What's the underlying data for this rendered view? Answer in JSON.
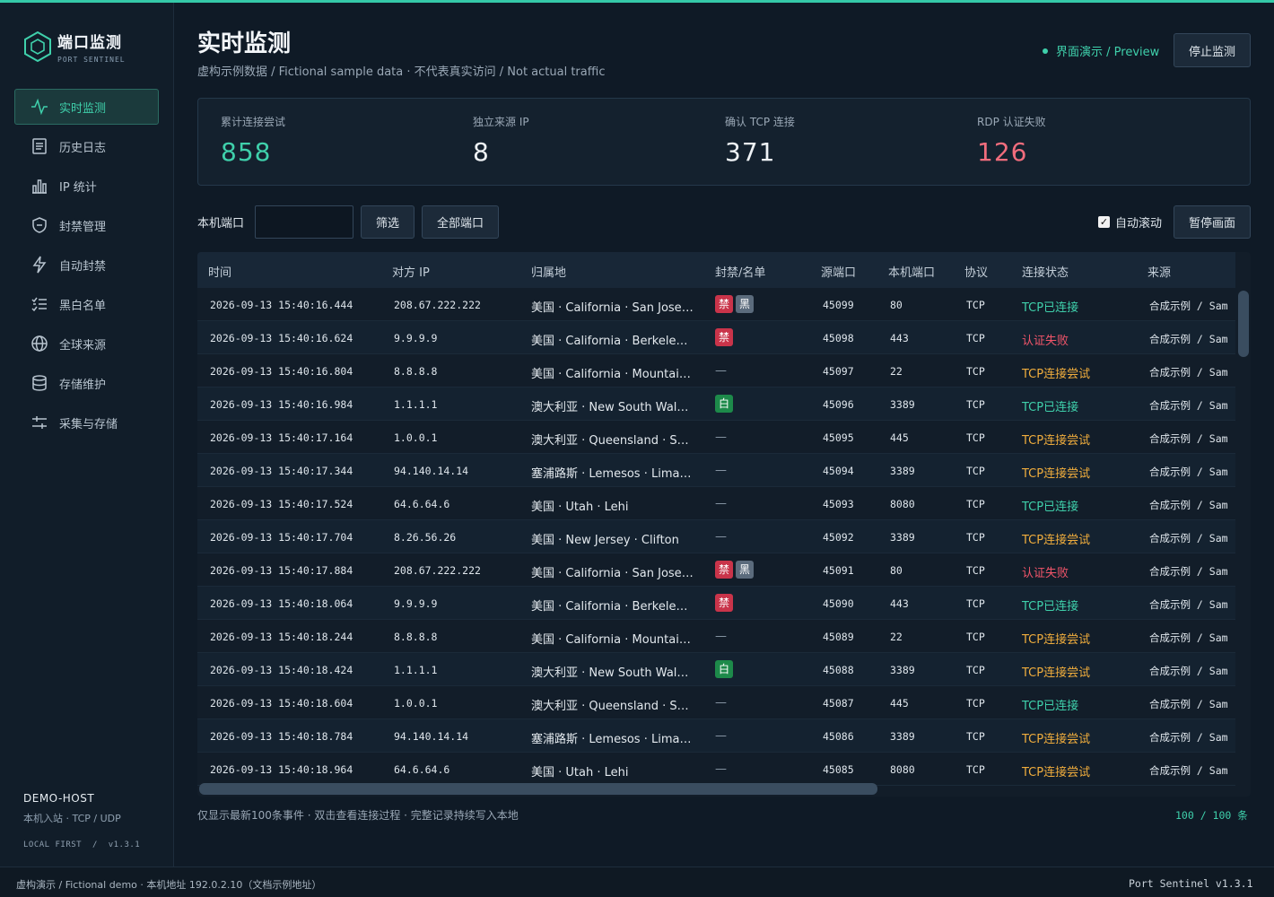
{
  "app": {
    "name": "端口监测",
    "subtitle": "PORT SENTINEL",
    "accent": "#3fd0ab"
  },
  "nav": [
    {
      "label": "实时监测",
      "icon": "pulse-icon",
      "active": true
    },
    {
      "label": "历史日志",
      "icon": "document-icon"
    },
    {
      "label": "IP 统计",
      "icon": "bar-chart-icon"
    },
    {
      "label": "封禁管理",
      "icon": "shield-icon"
    },
    {
      "label": "自动封禁",
      "icon": "lightning-icon"
    },
    {
      "label": "黑白名单",
      "icon": "checklist-icon"
    },
    {
      "label": "全球来源",
      "icon": "globe-icon"
    },
    {
      "label": "存储维护",
      "icon": "database-icon"
    },
    {
      "label": "采集与存储",
      "icon": "sliders-icon"
    }
  ],
  "host": {
    "name": "DEMO-HOST",
    "desc": "本机入站 · TCP / UDP",
    "version": "LOCAL FIRST  /  v1.3.1"
  },
  "header": {
    "title": "实时监测",
    "subtitle": "虚构示例数据 / Fictional sample data · 不代表真实访问 / Not actual traffic",
    "preview": "界面演示 / Preview",
    "stop_button": "停止监测"
  },
  "stats": [
    {
      "label": "累计连接尝试",
      "value": "858",
      "color": "#3fd0ab"
    },
    {
      "label": "独立来源 IP",
      "value": "8",
      "color": "#eef2f5"
    },
    {
      "label": "确认 TCP 连接",
      "value": "371",
      "color": "#eef2f5"
    },
    {
      "label": "RDP 认证失败",
      "value": "126",
      "color": "#f26d7d"
    }
  ],
  "filter": {
    "label": "本机端口",
    "placeholder": "",
    "filter_button": "筛选",
    "all_ports_button": "全部端口",
    "auto_scroll": "自动滚动",
    "auto_scroll_checked": true,
    "pause_button": "暂停画面"
  },
  "table": {
    "columns": [
      "时间",
      "对方 IP",
      "归属地",
      "封禁/名单",
      "源端口",
      "本机端口",
      "协议",
      "连接状态",
      "来源"
    ],
    "status_colors": {
      "ok": "#3fd0ab",
      "fail": "#f2556a",
      "try": "#f0ad3d"
    },
    "rows": [
      {
        "time": "2026-09-13 15:40:16.444",
        "ip": "208.67.222.222",
        "loc": "美国 · California · San Jose (...",
        "tags": [
          "禁",
          "黑"
        ],
        "sport": "45099",
        "lport": "80",
        "proto": "TCP",
        "status": "TCP已连接",
        "st": "ok",
        "src": "合成示例 / Sam"
      },
      {
        "time": "2026-09-13 15:40:16.624",
        "ip": "9.9.9.9",
        "loc": "美国 · California · Berkeley (...",
        "tags": [
          "禁"
        ],
        "sport": "45098",
        "lport": "443",
        "proto": "TCP",
        "status": "认证失败",
        "st": "fail",
        "src": "合成示例 / Sam"
      },
      {
        "time": "2026-09-13 15:40:16.804",
        "ip": "8.8.8.8",
        "loc": "美国 · California · Mountain...",
        "tags": [],
        "sport": "45097",
        "lport": "22",
        "proto": "TCP",
        "status": "TCP连接尝试",
        "st": "try",
        "src": "合成示例 / Sam"
      },
      {
        "time": "2026-09-13 15:40:16.984",
        "ip": "1.1.1.1",
        "loc": "澳大利亚 · New South Wale...",
        "tags": [
          "白"
        ],
        "sport": "45096",
        "lport": "3389",
        "proto": "TCP",
        "status": "TCP已连接",
        "st": "ok",
        "src": "合成示例 / Sam"
      },
      {
        "time": "2026-09-13 15:40:17.164",
        "ip": "1.0.0.1",
        "loc": "澳大利亚 · Queensland · So...",
        "tags": [],
        "sport": "45095",
        "lport": "445",
        "proto": "TCP",
        "status": "TCP连接尝试",
        "st": "try",
        "src": "合成示例 / Sam"
      },
      {
        "time": "2026-09-13 15:40:17.344",
        "ip": "94.140.14.14",
        "loc": "塞浦路斯 · Lemesos · Limassol",
        "tags": [],
        "sport": "45094",
        "lport": "3389",
        "proto": "TCP",
        "status": "TCP连接尝试",
        "st": "try",
        "src": "合成示例 / Sam"
      },
      {
        "time": "2026-09-13 15:40:17.524",
        "ip": "64.6.64.6",
        "loc": "美国 · Utah · Lehi",
        "tags": [],
        "sport": "45093",
        "lport": "8080",
        "proto": "TCP",
        "status": "TCP已连接",
        "st": "ok",
        "src": "合成示例 / Sam"
      },
      {
        "time": "2026-09-13 15:40:17.704",
        "ip": "8.26.56.26",
        "loc": "美国 · New Jersey · Clifton",
        "tags": [],
        "sport": "45092",
        "lport": "3389",
        "proto": "TCP",
        "status": "TCP连接尝试",
        "st": "try",
        "src": "合成示例 / Sam"
      },
      {
        "time": "2026-09-13 15:40:17.884",
        "ip": "208.67.222.222",
        "loc": "美国 · California · San Jose (...",
        "tags": [
          "禁",
          "黑"
        ],
        "sport": "45091",
        "lport": "80",
        "proto": "TCP",
        "status": "认证失败",
        "st": "fail",
        "src": "合成示例 / Sam"
      },
      {
        "time": "2026-09-13 15:40:18.064",
        "ip": "9.9.9.9",
        "loc": "美国 · California · Berkeley (...",
        "tags": [
          "禁"
        ],
        "sport": "45090",
        "lport": "443",
        "proto": "TCP",
        "status": "TCP已连接",
        "st": "ok",
        "src": "合成示例 / Sam"
      },
      {
        "time": "2026-09-13 15:40:18.244",
        "ip": "8.8.8.8",
        "loc": "美国 · California · Mountain...",
        "tags": [],
        "sport": "45089",
        "lport": "22",
        "proto": "TCP",
        "status": "TCP连接尝试",
        "st": "try",
        "src": "合成示例 / Sam"
      },
      {
        "time": "2026-09-13 15:40:18.424",
        "ip": "1.1.1.1",
        "loc": "澳大利亚 · New South Wale...",
        "tags": [
          "白"
        ],
        "sport": "45088",
        "lport": "3389",
        "proto": "TCP",
        "status": "TCP连接尝试",
        "st": "try",
        "src": "合成示例 / Sam"
      },
      {
        "time": "2026-09-13 15:40:18.604",
        "ip": "1.0.0.1",
        "loc": "澳大利亚 · Queensland · So...",
        "tags": [],
        "sport": "45087",
        "lport": "445",
        "proto": "TCP",
        "status": "TCP已连接",
        "st": "ok",
        "src": "合成示例 / Sam"
      },
      {
        "time": "2026-09-13 15:40:18.784",
        "ip": "94.140.14.14",
        "loc": "塞浦路斯 · Lemesos · Limassol",
        "tags": [],
        "sport": "45086",
        "lport": "3389",
        "proto": "TCP",
        "status": "TCP连接尝试",
        "st": "try",
        "src": "合成示例 / Sam"
      },
      {
        "time": "2026-09-13 15:40:18.964",
        "ip": "64.6.64.6",
        "loc": "美国 · Utah · Lehi",
        "tags": [],
        "sport": "45085",
        "lport": "8080",
        "proto": "TCP",
        "status": "TCP连接尝试",
        "st": "try",
        "src": "合成示例 / Sam"
      }
    ],
    "empty_tag": "—",
    "footnote": "仅显示最新100条事件 · 双击查看连接过程 · 完整记录持续写入本地",
    "count": "100 / 100 条"
  },
  "statusbar": {
    "left": "虚构演示 / Fictional demo · 本机地址 192.0.2.10（文档示例地址）",
    "right": "Port Sentinel v1.3.1"
  }
}
